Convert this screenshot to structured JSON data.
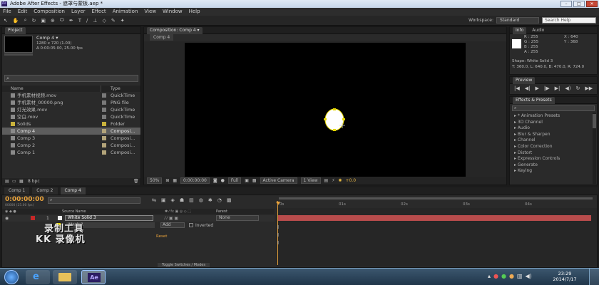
{
  "titlebar": {
    "title": "Adobe After Effects - 遮罩与蒙板.aep *"
  },
  "menu": {
    "items": [
      "File",
      "Edit",
      "Composition",
      "Layer",
      "Effect",
      "Animation",
      "View",
      "Window",
      "Help"
    ]
  },
  "toolbar": {
    "workspace_label": "Workspace:",
    "workspace_value": "Standard",
    "search_placeholder": "Search Help"
  },
  "project": {
    "tab": "Project",
    "thumb_name": "Comp 4 ▾",
    "thumb_info1": "1280 x 720 (1.00)",
    "thumb_info2": "Δ 0:00:05:00, 25.00 fps",
    "search_placeholder": "",
    "col_name": "Name",
    "col_type": "Type",
    "items": [
      {
        "name": "手机素材视频.mov",
        "type": "QuickTime",
        "color": "#7a7a7a"
      },
      {
        "name": "手机素材_00000.png",
        "type": "PNG file",
        "color": "#7a7a7a"
      },
      {
        "name": "灯光效果.mov",
        "type": "QuickTime",
        "color": "#7a7a7a"
      },
      {
        "name": "空白.mov",
        "type": "QuickTime",
        "color": "#7a7a7a"
      },
      {
        "name": "Solids",
        "type": "Folder",
        "color": "#c9b23c"
      },
      {
        "name": "Comp 4",
        "type": "Composi...",
        "color": "#b3a47a"
      },
      {
        "name": "Comp 3",
        "type": "Composi...",
        "color": "#b3a47a"
      },
      {
        "name": "Comp 2",
        "type": "Composi...",
        "color": "#b3a47a"
      },
      {
        "name": "Comp 1",
        "type": "Composi...",
        "color": "#b3a47a"
      }
    ],
    "bpc": "8 bpc"
  },
  "composition": {
    "tab": "Composition: Comp 4 ▾",
    "subtab": "Comp 4",
    "zoom": "50%",
    "timecode": "0:00:00:00",
    "resolution": "Full",
    "camera": "Active Camera",
    "views": "1 View",
    "exposure": "+0.0"
  },
  "info": {
    "tab": "Info",
    "tab2": "Audio",
    "r": "R : 255",
    "g": "G : 255",
    "b": "B : 255",
    "a": "A : 255",
    "x": "X : 640",
    "y": "Y : 368",
    "shape": "Shape: White Solid 3",
    "bounds": "T: 360.0, L: 640.0, B: 470.0, R: 724.0"
  },
  "preview": {
    "tab": "Preview"
  },
  "effects": {
    "tab": "Effects & Presets",
    "items": [
      "* Animation Presets",
      "3D Channel",
      "Audio",
      "Blur & Sharpen",
      "Channel",
      "Color Correction",
      "Distort",
      "Expression Controls",
      "Generate",
      "Keying"
    ]
  },
  "timeline": {
    "tabs": [
      "Comp 1",
      "Comp 2",
      "Comp 4"
    ],
    "timecode": "0:00:00:00",
    "timecode_sub": "00000 (25.00 fps)",
    "col_source": "Source Name",
    "col_parent": "Parent",
    "layer_num": "1",
    "layer_name": "White Solid 3",
    "parent_value": "None",
    "mask_name": "Mask 1",
    "mask_mode": "Add",
    "inverted_label": "Inverted",
    "reset_label": "Reset",
    "ruler": [
      "0s",
      "01s",
      "02s",
      "03s",
      "04s"
    ],
    "toggle_label": "Toggle Switches / Modes"
  },
  "watermark": {
    "line1": "录制工具",
    "line2": "KK 录像机"
  },
  "taskbar": {
    "app_label": "Ae",
    "time": "23:29",
    "date": "2014/7/17"
  }
}
